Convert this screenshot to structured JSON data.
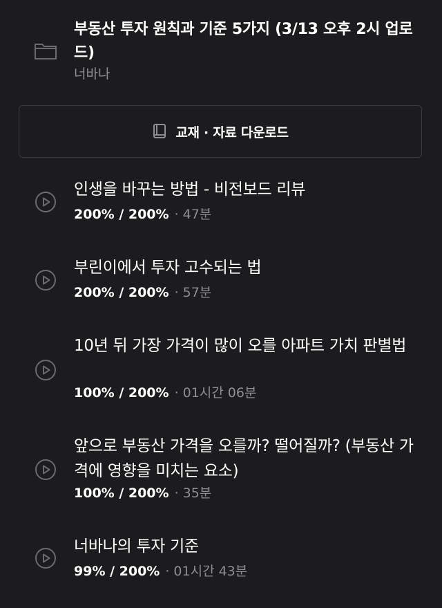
{
  "section": {
    "title": "부동산 투자 원칙과 기준 5가지 (3/13 오후 2시 업로드)",
    "author": "너바나",
    "icon": "folder-icon"
  },
  "download": {
    "label": "교재 · 자료 다운로드",
    "icon": "book-icon"
  },
  "lessons": [
    {
      "title": "인생을 바꾸는 방법 - 비전보드 리뷰",
      "progress": "200% / 200%",
      "separator": "·",
      "duration": "47분",
      "icon": "play-circle-icon"
    },
    {
      "title": "부린이에서 투자 고수되는 법",
      "progress": "200% / 200%",
      "separator": "·",
      "duration": "57분",
      "icon": "play-circle-icon"
    },
    {
      "title": "10년 뒤 가장 가격이 많이 오를 아파트 가치 판별법",
      "progress": "100% / 200%",
      "separator": "·",
      "duration": "01시간 06분",
      "icon": "play-circle-icon"
    },
    {
      "title": "앞으로 부동산 가격을 오를까? 떨어질까? (부동산 가격에 영향을 미치는 요소)",
      "progress": "100% / 200%",
      "separator": "·",
      "duration": "35분",
      "icon": "play-circle-icon"
    },
    {
      "title": "너바나의 투자 기준",
      "progress": "99% / 200%",
      "separator": "·",
      "duration": "01시간 43분",
      "icon": "play-circle-icon"
    }
  ],
  "colors": {
    "background": "#1c1c1e",
    "text_primary": "#ffffff",
    "text_secondary": "#8e8e93",
    "border": "#3a3a3f"
  }
}
